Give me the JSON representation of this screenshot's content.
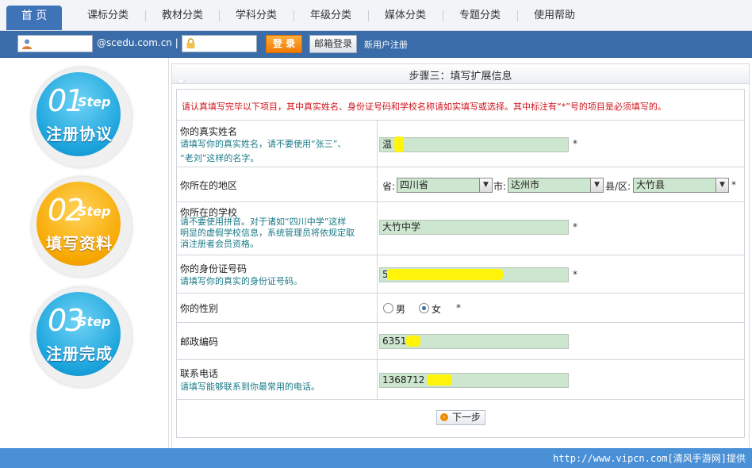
{
  "nav": {
    "items": [
      "首 页",
      "课标分类",
      "教材分类",
      "学科分类",
      "年级分类",
      "媒体分类",
      "专题分类",
      "使用帮助"
    ]
  },
  "login": {
    "domain": "@scedu.com.cn |",
    "login_btn": "登 录",
    "mail_btn": "邮箱登录",
    "register": "新用户注册"
  },
  "steps": [
    {
      "num": "01",
      "step": "Step",
      "name": "注册协议",
      "color": "blue"
    },
    {
      "num": "02",
      "step": "Step",
      "name": "填写资料",
      "color": "orange"
    },
    {
      "num": "03",
      "step": "Step",
      "name": "注册完成",
      "color": "blue"
    }
  ],
  "form": {
    "title": "步骤三：填写扩展信息",
    "notice": "请认真填写完毕以下项目，其中真实姓名、身份证号码和学校名称请如实填写或选择。其中标注有“*”号的项目是必须填写的。",
    "star": "*",
    "realname": {
      "label": "你的真实姓名",
      "hint1": "请填写你的真实姓名，请不要使用“张三”、",
      "hint2": "“老刘”这样的名字。",
      "value": "温"
    },
    "region": {
      "label": "你所在的地区",
      "prov_label": "省:",
      "prov": "四川省",
      "city_label": "市:",
      "city": "达州市",
      "county_label": "县/区:",
      "county": "大竹县"
    },
    "school": {
      "label": "你所在的学校",
      "hint1": "请不要使用拼音。对于诸如“四川中学”这样",
      "hint2": "明显的虚假学校信息，系统管理员将依规定取",
      "hint3": "消注册者会员资格。",
      "value": "大竹中学"
    },
    "idcard": {
      "label": "你的身份证号码",
      "hint": "请填写你的真实的身份证号码。",
      "value": "5"
    },
    "gender": {
      "label": "你的性别",
      "male": "男",
      "female": "女"
    },
    "postcode": {
      "label": "邮政编码",
      "value": "6351"
    },
    "phone": {
      "label": "联系电话",
      "hint": "请填写能够联系到你最常用的电话。",
      "value": "1368712"
    },
    "next_btn": "下一步"
  },
  "footer": {
    "text": "http://www.vipcn.com[清风手游网]提供"
  }
}
